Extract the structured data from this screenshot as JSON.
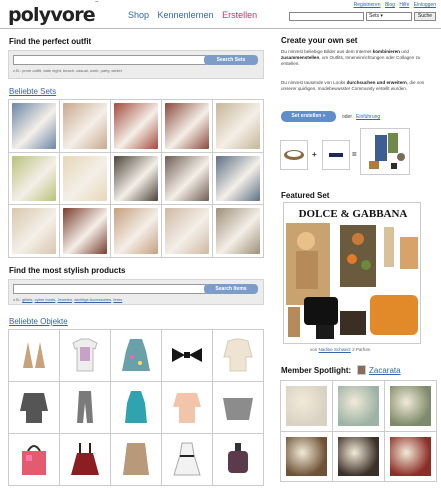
{
  "header": {
    "logo": "polyvore",
    "logo_mark": "™",
    "nav": {
      "shop": "Shop",
      "kennenlernen": "Kennenlernen",
      "erstellen": "Erstellen"
    },
    "top_links": [
      "Registrieren",
      "Blog",
      "Hilfe",
      "Einloggen"
    ],
    "search": {
      "value": "",
      "select": "Sets",
      "button": "Suche"
    }
  },
  "outfit": {
    "title": "Find the perfect outfit",
    "placeholder": "",
    "button": "Search Sets",
    "hint": "z.B.: prom outfit, date night, beach, casual, work, party, winter"
  },
  "sets": {
    "title": "Beliebte Sets",
    "thumbs": [
      "#6b86a8",
      "#c9a98e",
      "#a34a3c",
      "#8b4a3e",
      "#c6b69a",
      "#b9c27a",
      "#e7d7b8",
      "#4b4438",
      "#6f5d54",
      "#5d6f86",
      "#d8c7ad",
      "#7a3d2f",
      "#c59f7e",
      "#cfb9a3",
      "#9e8f79"
    ]
  },
  "products": {
    "title": "Find the most stylish products",
    "placeholder": "",
    "button": "Search Items",
    "hint_prefix": "z.B.:",
    "hints": [
      "gillets",
      "cyber boots",
      "Jeweles",
      "wichtige Accessoires",
      "feres"
    ]
  },
  "items": {
    "title": "Beliebte Objekte",
    "entries": [
      {
        "name": "earrings",
        "color": "#c7a27a"
      },
      {
        "name": "print-tee",
        "color": "#c9a1c7"
      },
      {
        "name": "floral-dress",
        "color": "#6aa0a8"
      },
      {
        "name": "bow",
        "color": "#151515"
      },
      {
        "name": "cream-blouse",
        "color": "#efe4d2"
      },
      {
        "name": "grey-cardigan",
        "color": "#555555"
      },
      {
        "name": "scarf",
        "color": "#7a7a7a"
      },
      {
        "name": "teal-top",
        "color": "#2fa3b0"
      },
      {
        "name": "peach-blouse",
        "color": "#f2c4aa"
      },
      {
        "name": "grey-wrap",
        "color": "#8c8c8c"
      },
      {
        "name": "tote-bag",
        "color": "#e25b6e"
      },
      {
        "name": "red-skirt",
        "color": "#8a1e22"
      },
      {
        "name": "camel-coat",
        "color": "#b89a7b"
      },
      {
        "name": "white-dress",
        "color": "#f2f2f2"
      },
      {
        "name": "perfume",
        "color": "#5c3a4e"
      }
    ]
  },
  "create": {
    "title": "Create your own set",
    "para1": [
      "Du nimmst beliebige Bilder aus dem Internet ",
      "kombinieren",
      " und ",
      "zusammenstellen",
      ", um Outfits, Inneneinrichtungen oder Collagen zu erstellen."
    ],
    "para2": [
      "Du nimmst tausende von Looks ",
      "durchsuchen und erweitern",
      ", die von unserer quirligen, modebewusster Community erstellt wurden."
    ],
    "button": "Set erstellen »",
    "oder": "oder",
    "link": "Einführung",
    "plus": "+",
    "equals": "="
  },
  "featured": {
    "title": "Featured Set",
    "brand": "DOLCE & GABBANA",
    "credit_prefix": "von",
    "credit_name": "Nadine Schweiz",
    "credit_suffix": "2 Parfüm"
  },
  "spotlight": {
    "title": "Member Spotlight:",
    "name": "Zacarata",
    "thumbs": [
      "#d9d2c4",
      "#9db3a6",
      "#7e8a6a",
      "#6e5236",
      "#3b3028",
      "#8c2d26"
    ]
  }
}
